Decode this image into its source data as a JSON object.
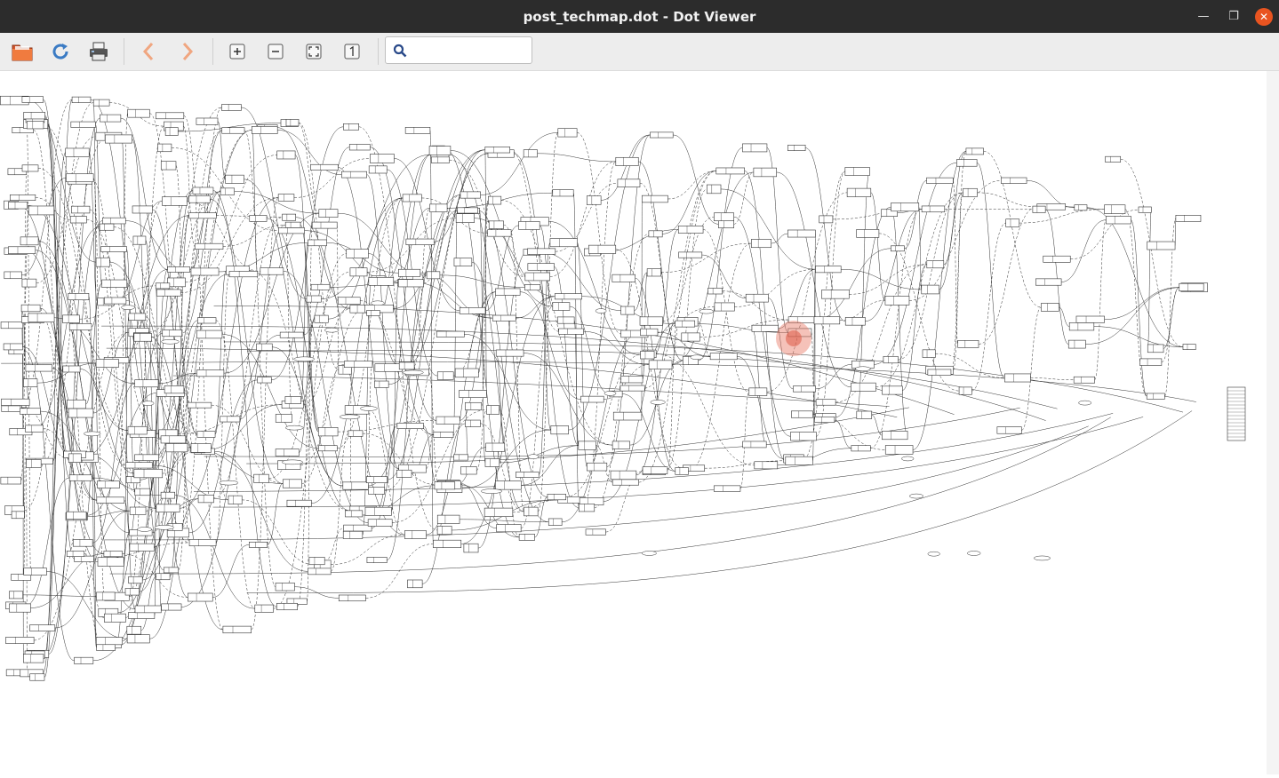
{
  "window": {
    "title": "post_techmap.dot - Dot Viewer",
    "controls": {
      "minimize_glyph": "—",
      "maximize_glyph": "❐",
      "close_glyph": "✕"
    }
  },
  "toolbar": {
    "buttons": [
      {
        "name": "open-button",
        "icon": "folder-icon"
      },
      {
        "name": "reload-button",
        "icon": "refresh-icon"
      },
      {
        "name": "print-button",
        "icon": "printer-icon"
      },
      {
        "name": "back-button",
        "icon": "chevron-left-icon"
      },
      {
        "name": "forward-button",
        "icon": "chevron-right-icon"
      },
      {
        "name": "zoom-in-button",
        "icon": "zoom-in-icon"
      },
      {
        "name": "zoom-out-button",
        "icon": "zoom-out-icon"
      },
      {
        "name": "zoom-fit-button",
        "icon": "zoom-fit-icon"
      },
      {
        "name": "zoom-100-button",
        "icon": "zoom-original-icon"
      }
    ],
    "search": {
      "value": "",
      "placeholder": "",
      "icon": "search-icon"
    }
  },
  "colors": {
    "titlebar": "#2c2c2c",
    "toolbar": "#ededed",
    "close": "#e95420",
    "graph_stroke": "#333333"
  }
}
